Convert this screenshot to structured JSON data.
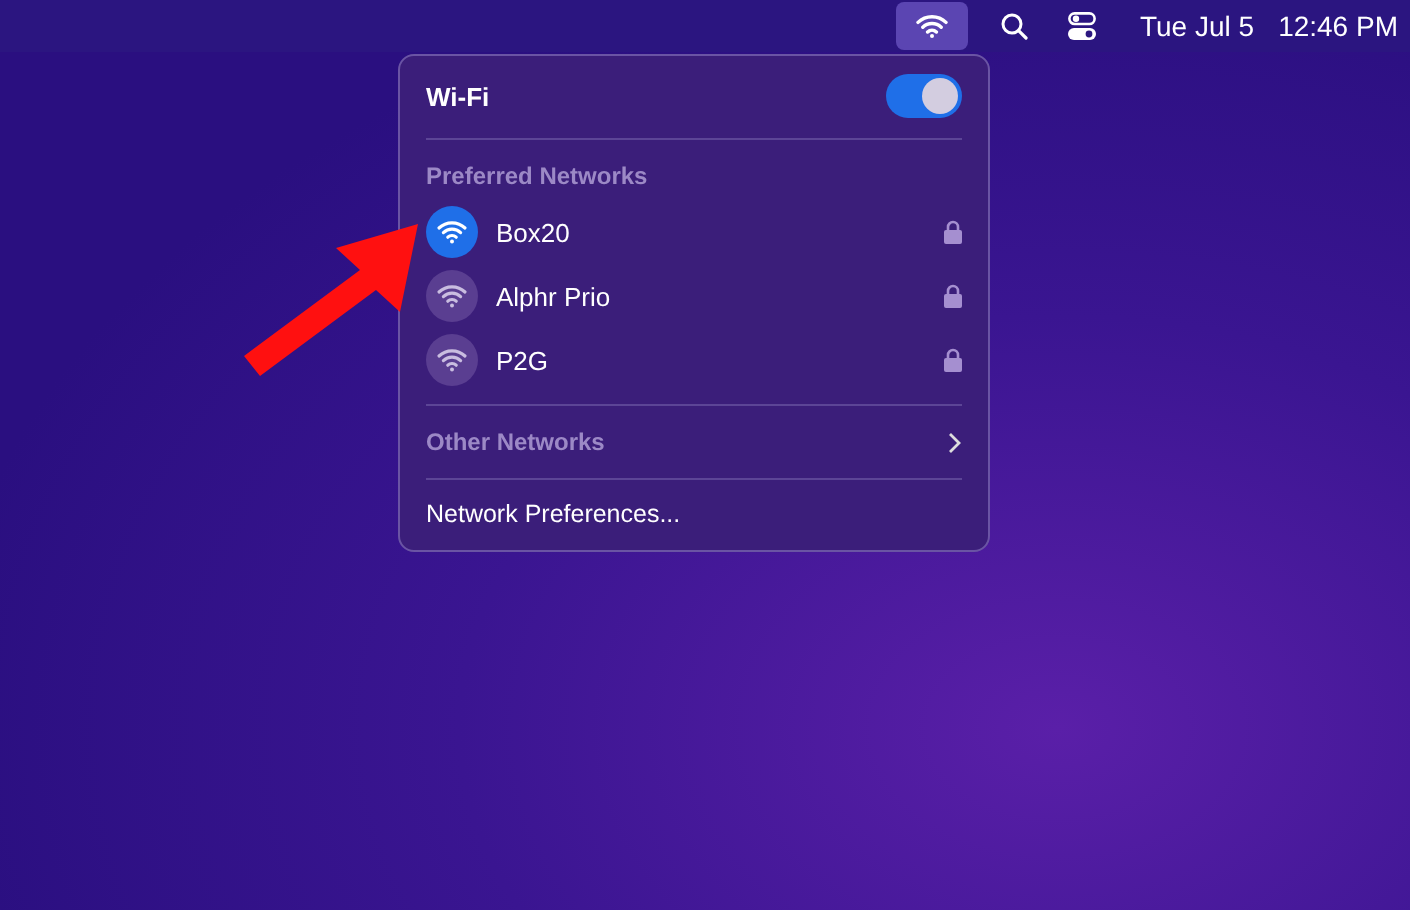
{
  "menu_bar": {
    "wifi_selected": true,
    "date": "Tue Jul 5",
    "time": "12:46 PM"
  },
  "wifi_menu": {
    "title": "Wi-Fi",
    "wifi_on": true,
    "preferred_heading": "Preferred Networks",
    "networks": [
      {
        "name": "Box20",
        "connected": true,
        "locked": true
      },
      {
        "name": "Alphr Prio",
        "connected": false,
        "locked": true
      },
      {
        "name": "P2G",
        "connected": false,
        "locked": true
      }
    ],
    "other_networks": "Other Networks",
    "preferences": "Network Preferences..."
  }
}
